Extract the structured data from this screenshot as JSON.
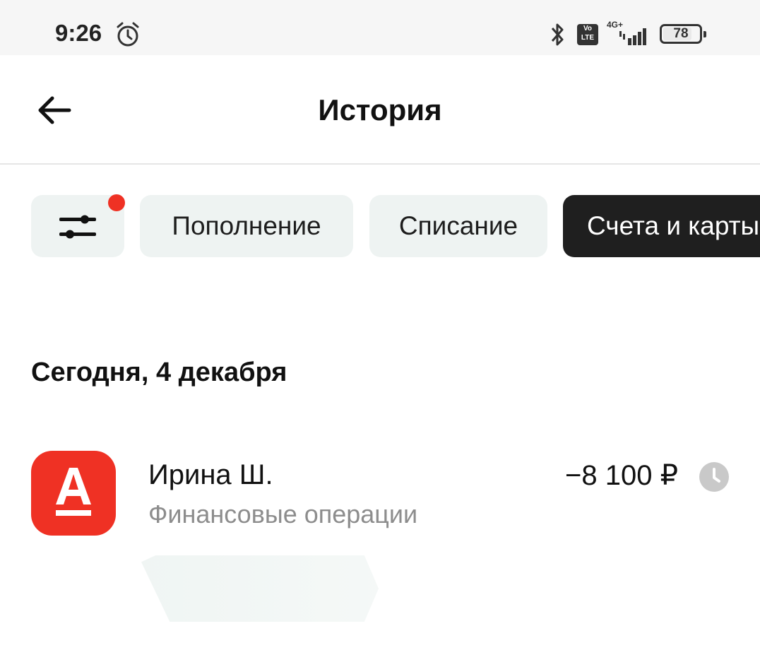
{
  "status_bar": {
    "time": "9:26",
    "network_label": "4G+",
    "volte_top": "Vo",
    "volte_bottom": "LTE",
    "battery_level": "78",
    "icons": [
      "alarm-icon",
      "bluetooth-icon",
      "volte-icon",
      "signal-icon",
      "battery-icon"
    ]
  },
  "header": {
    "title": "История",
    "back_icon": "arrow-left-icon"
  },
  "filters": {
    "filter_icon": "sliders-icon",
    "has_active_filter_dot": true,
    "chips": [
      {
        "label": "Пополнение",
        "selected": false
      },
      {
        "label": "Списание",
        "selected": false
      },
      {
        "label": "Счета и карты",
        "selected": true
      }
    ]
  },
  "section": {
    "date_label": "Сегодня, 4 декабря"
  },
  "transactions": [
    {
      "name": "Ирина Ш.",
      "category": "Финансовые операции",
      "amount": "−8 100 ₽",
      "logo_icon": "alfa-bank-logo-icon",
      "status_icon": "clock-icon",
      "status": "pending"
    }
  ],
  "colors": {
    "brand_red": "#ef3124",
    "chip_bg": "#eef3f2",
    "chip_selected_bg": "#1f1f1f",
    "secondary_text": "#8d8d8d"
  }
}
